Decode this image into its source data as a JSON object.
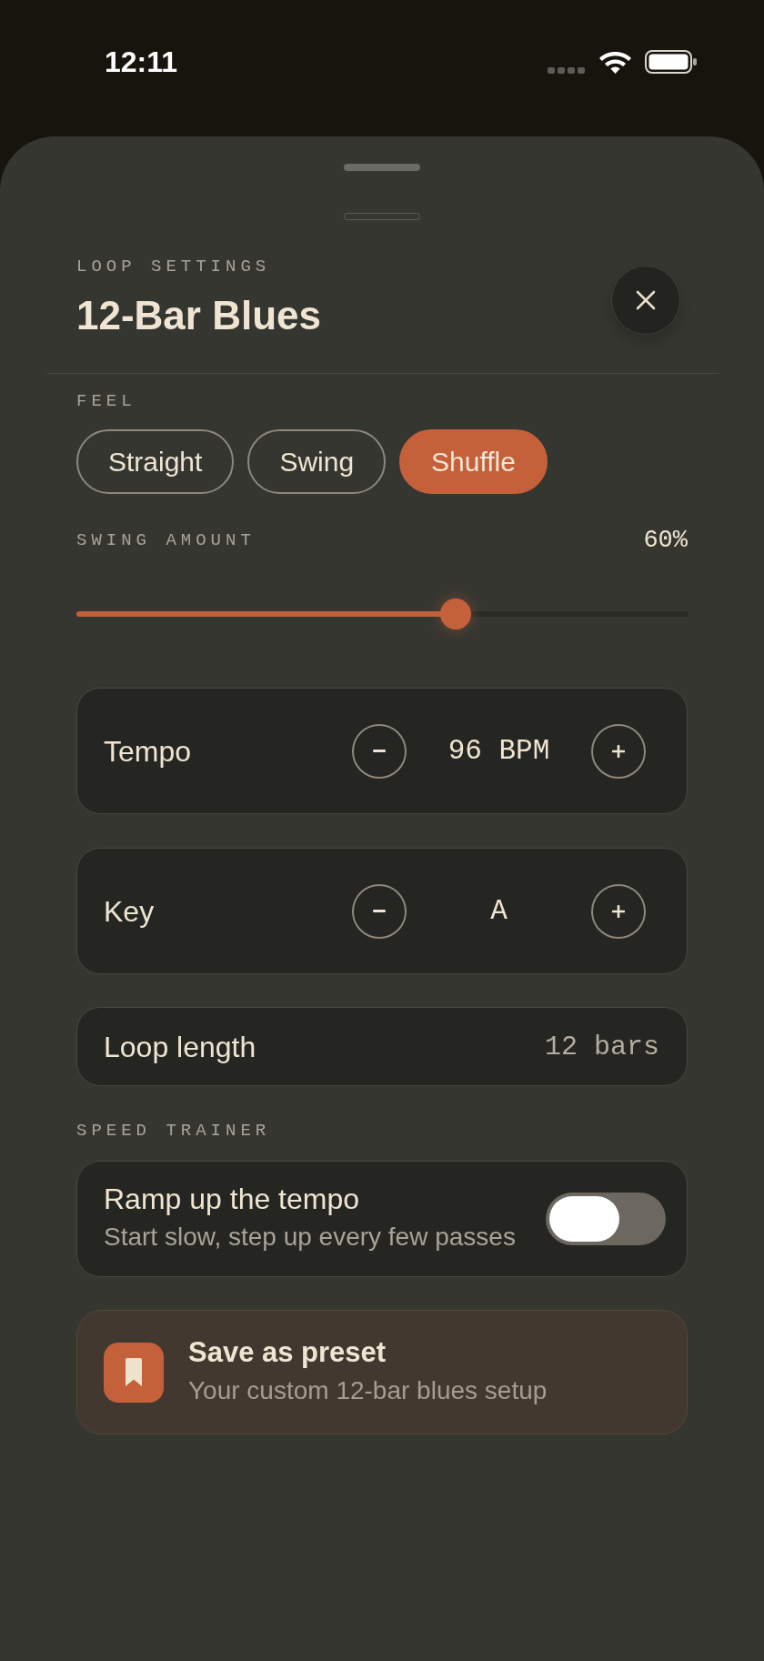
{
  "status_bar": {
    "time": "12:11"
  },
  "sheet": {
    "eyebrow": "LOOP SETTINGS",
    "title": "12-Bar Blues"
  },
  "feel": {
    "label": "FEEL",
    "options": [
      {
        "label": "Straight",
        "selected": false
      },
      {
        "label": "Swing",
        "selected": false
      },
      {
        "label": "Shuffle",
        "selected": true
      }
    ]
  },
  "swing_amount": {
    "label": "SWING AMOUNT",
    "reading": "60%",
    "level": 0.62
  },
  "settings": [
    {
      "kind": "stepper",
      "label": "Tempo",
      "value": "96 BPM"
    },
    {
      "kind": "stepper",
      "label": "Key",
      "value": "A"
    },
    {
      "kind": "value",
      "label": "Loop length",
      "value": "12 bars"
    }
  ],
  "speed_trainer": {
    "label": "SPEED TRAINER",
    "title": "Ramp up the tempo",
    "subtitle": "Start slow, step up every few passes",
    "on": false
  },
  "preset": {
    "title": "Save as preset",
    "subtitle": "Your custom 12-bar blues setup"
  }
}
